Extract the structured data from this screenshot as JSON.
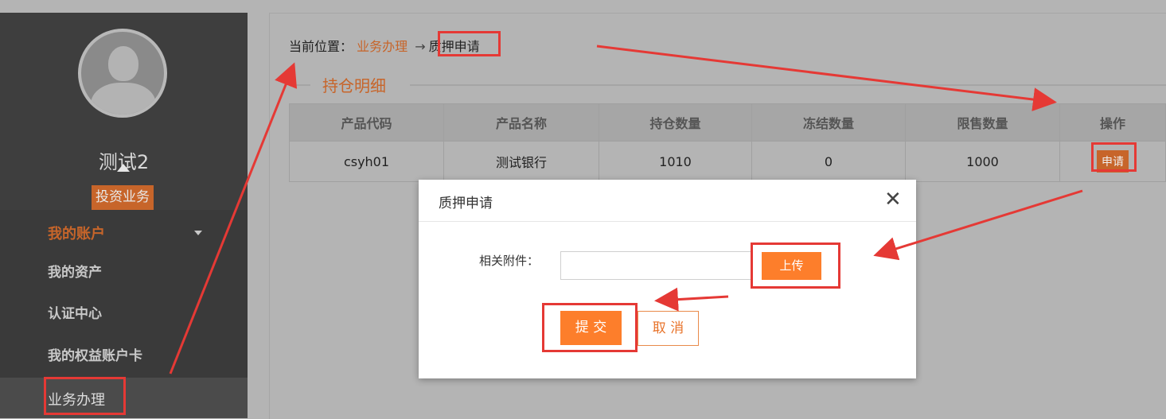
{
  "sidebar": {
    "username": "测试2",
    "role_badge": "投资业务",
    "section_title": "我的账户",
    "items": [
      {
        "label": "我的资产"
      },
      {
        "label": "认证中心"
      },
      {
        "label": "我的权益账户卡"
      }
    ],
    "business_item": "业务办理"
  },
  "breadcrumb": {
    "prefix": "当前位置：",
    "link": "业务办理",
    "arrow": "→",
    "current": "质押申请"
  },
  "holdings": {
    "title": "持仓明细",
    "columns": [
      "产品代码",
      "产品名称",
      "持仓数量",
      "冻结数量",
      "限售数量",
      "操作"
    ],
    "rows": [
      {
        "code": "csyh01",
        "name": "测试银行",
        "qty": "1010",
        "frozen": "0",
        "restricted": "1000",
        "action": "申请"
      }
    ]
  },
  "modal": {
    "title": "质押申请",
    "close_glyph": "✕",
    "attachment_label": "相关附件：",
    "upload_label": "上传",
    "submit_label": "提 交",
    "cancel_label": "取 消"
  },
  "colors": {
    "accent": "#c7652a",
    "button_orange": "#fd7e2b",
    "annotation_red": "#e53935"
  }
}
